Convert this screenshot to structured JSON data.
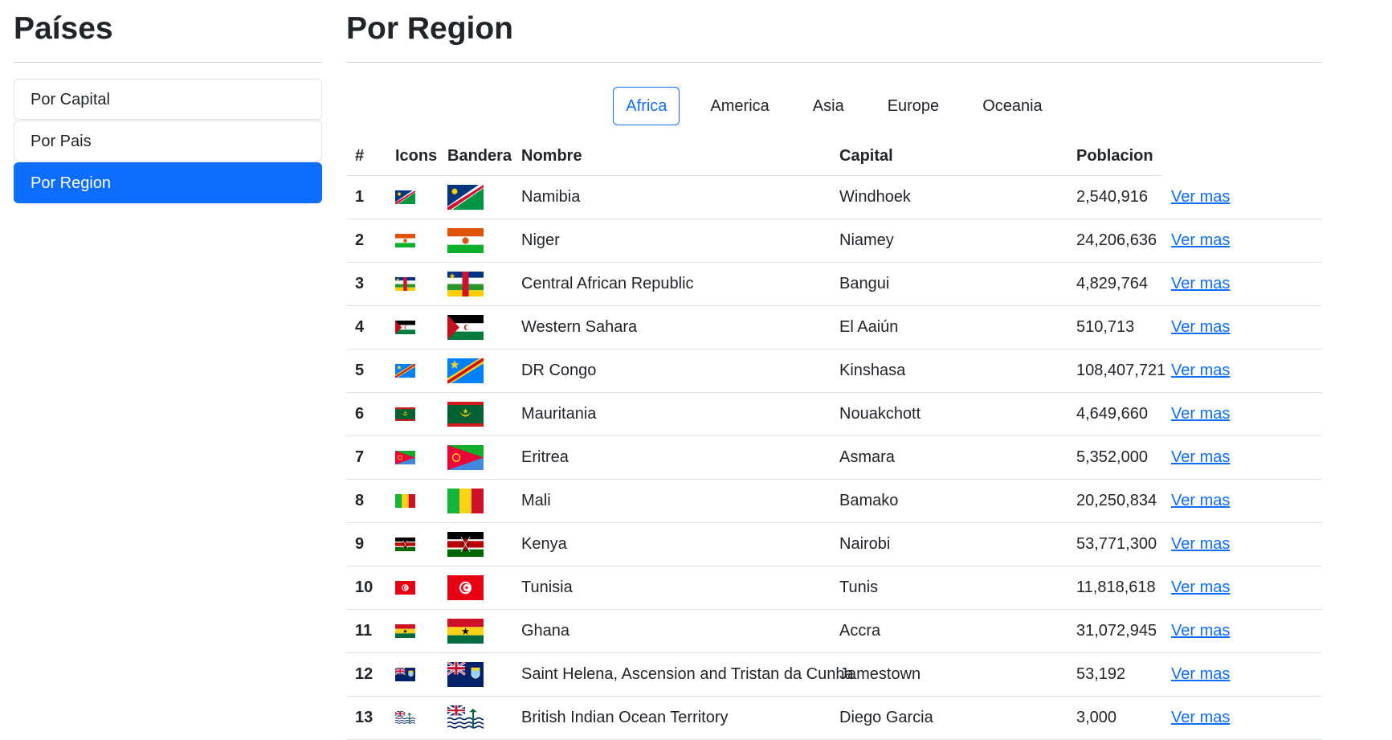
{
  "sidebar": {
    "title": "Países",
    "items": [
      {
        "label": "Por Capital",
        "active": false
      },
      {
        "label": "Por Pais",
        "active": false
      },
      {
        "label": "Por Region",
        "active": true
      }
    ]
  },
  "main": {
    "title": "Por Region",
    "regions": [
      "Africa",
      "America",
      "Asia",
      "Europe",
      "Oceania"
    ],
    "active_region": "Africa",
    "table": {
      "headers": [
        "#",
        "Icons",
        "Bandera",
        "Nombre",
        "Capital",
        "Poblacion"
      ],
      "link_label": "Ver mas",
      "rows": [
        {
          "num": "1",
          "name": "Namibia",
          "capital": "Windhoek",
          "population": "2,540,916",
          "flag": "namibia"
        },
        {
          "num": "2",
          "name": "Niger",
          "capital": "Niamey",
          "population": "24,206,636",
          "flag": "niger"
        },
        {
          "num": "3",
          "name": "Central African Republic",
          "capital": "Bangui",
          "population": "4,829,764",
          "flag": "car"
        },
        {
          "num": "4",
          "name": "Western Sahara",
          "capital": "El Aaiún",
          "population": "510,713",
          "flag": "western-sahara"
        },
        {
          "num": "5",
          "name": "DR Congo",
          "capital": "Kinshasa",
          "population": "108,407,721",
          "flag": "dr-congo"
        },
        {
          "num": "6",
          "name": "Mauritania",
          "capital": "Nouakchott",
          "population": "4,649,660",
          "flag": "mauritania"
        },
        {
          "num": "7",
          "name": "Eritrea",
          "capital": "Asmara",
          "population": "5,352,000",
          "flag": "eritrea"
        },
        {
          "num": "8",
          "name": "Mali",
          "capital": "Bamako",
          "population": "20,250,834",
          "flag": "mali"
        },
        {
          "num": "9",
          "name": "Kenya",
          "capital": "Nairobi",
          "population": "53,771,300",
          "flag": "kenya"
        },
        {
          "num": "10",
          "name": "Tunisia",
          "capital": "Tunis",
          "population": "11,818,618",
          "flag": "tunisia"
        },
        {
          "num": "11",
          "name": "Ghana",
          "capital": "Accra",
          "population": "31,072,945",
          "flag": "ghana"
        },
        {
          "num": "12",
          "name": "Saint Helena, Ascension and Tristan da Cunha",
          "capital": "Jamestown",
          "population": "53,192",
          "flag": "saint-helena"
        },
        {
          "num": "13",
          "name": "British Indian Ocean Territory",
          "capital": "Diego Garcia",
          "population": "3,000",
          "flag": "biot"
        }
      ]
    }
  },
  "colors": {
    "accent": "#0d6efd",
    "text": "#212529",
    "border": "#dee2e6"
  }
}
